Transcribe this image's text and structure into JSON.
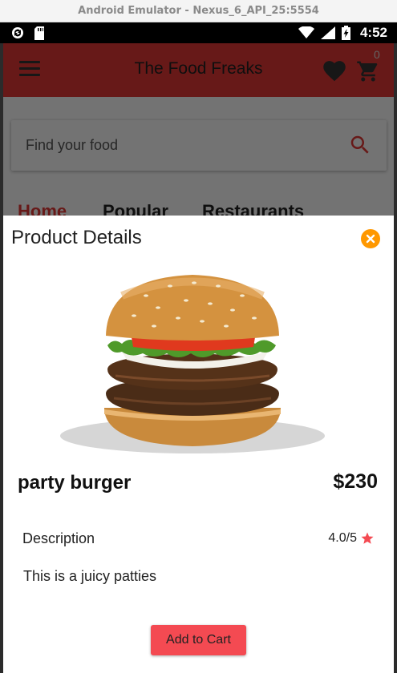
{
  "emulator": {
    "title": "Android Emulator - Nexus_6_API_25:5554"
  },
  "status_bar": {
    "time": "4:52",
    "icons": [
      "sync-icon",
      "sd-card-icon",
      "wifi-icon",
      "signal-icon",
      "battery-charging-icon"
    ]
  },
  "app_bar": {
    "title": "The Food Freaks",
    "cart_count": "0",
    "icons": [
      "menu-icon",
      "heart-icon",
      "cart-icon"
    ]
  },
  "search": {
    "placeholder": "Find your food"
  },
  "tabs": [
    {
      "label": "Home",
      "active": true
    },
    {
      "label": "Popular",
      "active": false
    },
    {
      "label": "Restaurants",
      "active": false
    }
  ],
  "product_sheet": {
    "title": "Product Details",
    "name": "party burger",
    "price": "$230",
    "description_heading": "Description",
    "rating": "4.0/5",
    "description": "This is a juicy patties",
    "add_button": "Add to Cart"
  },
  "colors": {
    "primary": "#e53935",
    "close_button": "#ff9800",
    "add_button": "#f44a52",
    "star": "#f44a52"
  }
}
